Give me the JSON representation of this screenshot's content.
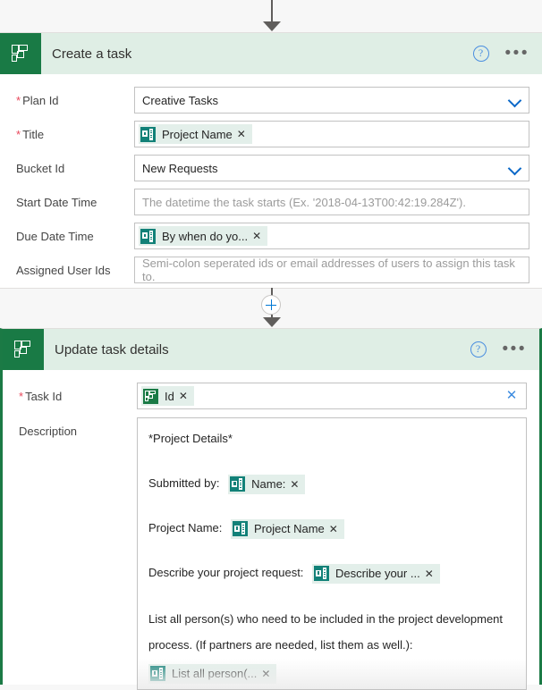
{
  "connector": {
    "top_arrow_icon": "arrow-down-icon",
    "insert_icon": "plus-circle-icon",
    "mid_arrow_icon": "arrow-down-icon"
  },
  "colors": {
    "brand_green": "#197a45",
    "header_green_tint": "#dfeee5",
    "token_bg": "#e3efea",
    "forms_teal": "#128178",
    "accent_blue": "#0b68c8",
    "required_red": "#e8475b",
    "selected_border": "#1b7a45"
  },
  "cards": [
    {
      "title": "Create a task",
      "app_icon": "planner-icon",
      "help_icon": "?",
      "menu_icon": "•••",
      "rows": [
        {
          "label": "Plan Id",
          "required": true,
          "type": "dropdown",
          "value": "Creative Tasks",
          "chevron_icon": "chevron-down-icon"
        },
        {
          "label": "Title",
          "required": true,
          "type": "token",
          "token": {
            "text": "Project Name",
            "icon": "forms-icon",
            "remove_icon": "✕"
          }
        },
        {
          "label": "Bucket Id",
          "required": false,
          "type": "dropdown",
          "value": "New Requests",
          "chevron_icon": "chevron-down-icon"
        },
        {
          "label": "Start Date Time",
          "required": false,
          "type": "text",
          "value": "",
          "placeholder": "The datetime the task starts (Ex. '2018-04-13T00:42:19.284Z')."
        },
        {
          "label": "Due Date Time",
          "required": false,
          "type": "token",
          "token": {
            "text": "By when do yo...",
            "icon": "forms-icon",
            "remove_icon": "✕"
          }
        },
        {
          "label": "Assigned User Ids",
          "required": false,
          "type": "text",
          "value": "",
          "placeholder": "Semi-colon seperated ids or email addresses of users to assign this task to."
        }
      ]
    },
    {
      "title": "Update task details",
      "app_icon": "planner-icon",
      "help_icon": "?",
      "menu_icon": "•••",
      "selected": true,
      "task_id": {
        "label": "Task Id",
        "required": true,
        "token": {
          "text": "Id",
          "icon": "planner-icon",
          "remove_icon": "✕"
        },
        "clear_icon": "✕"
      },
      "description": {
        "label": "Description",
        "lines": [
          {
            "kind": "text",
            "text": "*Project Details*"
          },
          {
            "kind": "label_token",
            "text": "Submitted by:",
            "token": {
              "text": "Name:",
              "icon": "forms-icon",
              "remove_icon": "✕"
            }
          },
          {
            "kind": "label_token",
            "text": "Project Name:",
            "token": {
              "text": "Project Name",
              "icon": "forms-icon",
              "remove_icon": "✕"
            }
          },
          {
            "kind": "label_token",
            "text": "Describe your project request:",
            "token": {
              "text": "Describe your ...",
              "icon": "forms-icon",
              "remove_icon": "✕"
            }
          },
          {
            "kind": "paragraph_token",
            "text": "List all person(s) who need to be included in the project development process. (If partners are needed, list them as well.):",
            "token": {
              "text": "List all person(...",
              "icon": "forms-icon",
              "remove_icon": "✕"
            }
          }
        ]
      }
    }
  ]
}
